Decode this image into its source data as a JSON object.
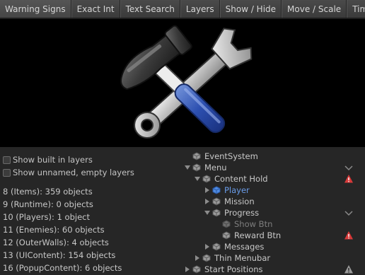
{
  "toolbar": {
    "tabs": [
      "Warning Signs",
      "Exact Int",
      "Text Search",
      "Layers",
      "Show / Hide",
      "Move / Scale",
      "Time"
    ]
  },
  "preview": {
    "image": "hammer-and-wrench-icon"
  },
  "layers_panel": {
    "show_built_in_label": "Show built in layers",
    "show_unnamed_label": "Show unnamed, empty layers",
    "layers": [
      "8 (Items): 359 objects",
      "9 (Runtime): 0 objects",
      "10 (Players): 1 object",
      "11 (Enemies): 60 objects",
      "12 (OuterWalls): 4 objects",
      "13 (UIContent): 154 objects",
      "16 (PopupContent): 6 objects"
    ]
  },
  "hierarchy": {
    "items": [
      {
        "label": "EventSystem"
      },
      {
        "label": "Menu"
      },
      {
        "label": "Content Hold"
      },
      {
        "label": "Player"
      },
      {
        "label": "Mission"
      },
      {
        "label": "Progress"
      },
      {
        "label": "Show Btn"
      },
      {
        "label": "Reward Btn"
      },
      {
        "label": "Messages"
      },
      {
        "label": "Thin Menubar"
      },
      {
        "label": "Start Positions"
      }
    ],
    "colors": {
      "warning_red": "#d83a3a",
      "warning_gray": "#9a9a9a",
      "selected_blue": "#6a9ce8"
    }
  }
}
